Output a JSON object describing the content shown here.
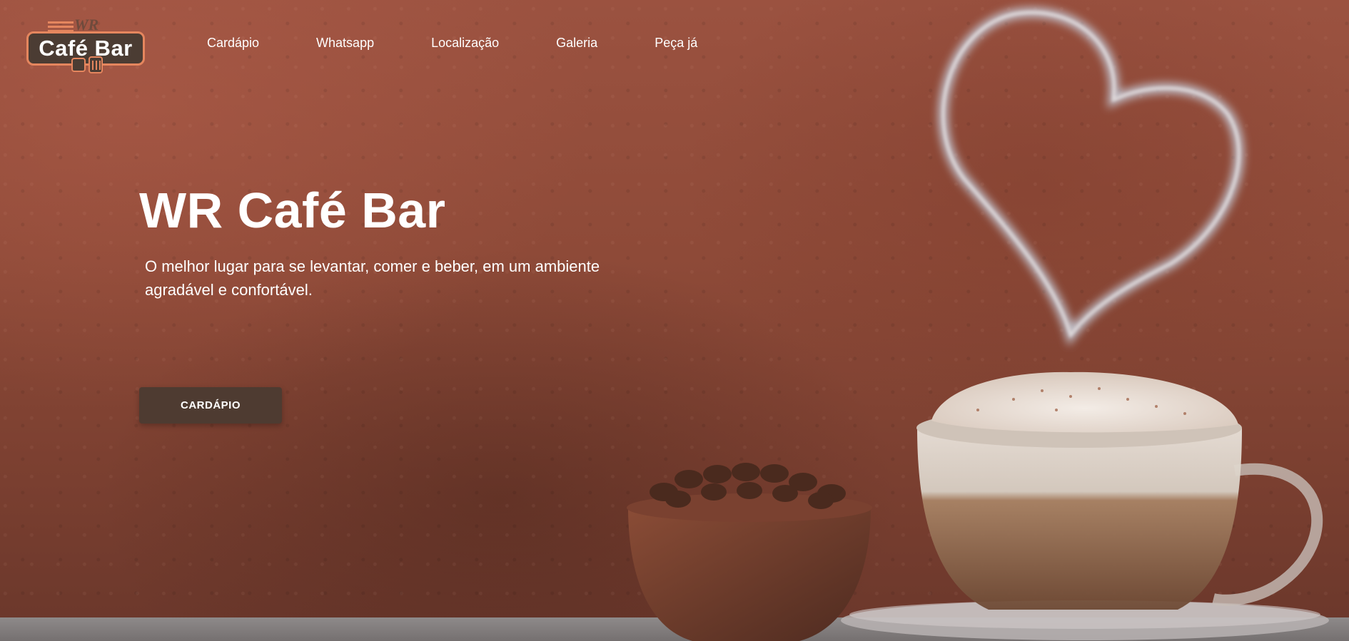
{
  "brand": {
    "logo_top": "WR",
    "logo_text": "Café Bar",
    "accent_color": "#e5865e"
  },
  "nav": {
    "items": [
      {
        "label": "Cardápio"
      },
      {
        "label": "Whatsapp"
      },
      {
        "label": "Localização"
      },
      {
        "label": "Galeria"
      },
      {
        "label": "Peça já"
      }
    ]
  },
  "hero": {
    "title": "WR Café Bar",
    "subtitle": "O melhor lugar para se levantar, comer e beber, em um ambiente agradável e confortável.",
    "cta_label": "CARDÁPIO",
    "cta_color": "#4e3b31"
  },
  "illustration": {
    "elements": [
      "smoke-heart",
      "coffee-bean-bowl",
      "cappuccino-cup",
      "saucer"
    ]
  }
}
